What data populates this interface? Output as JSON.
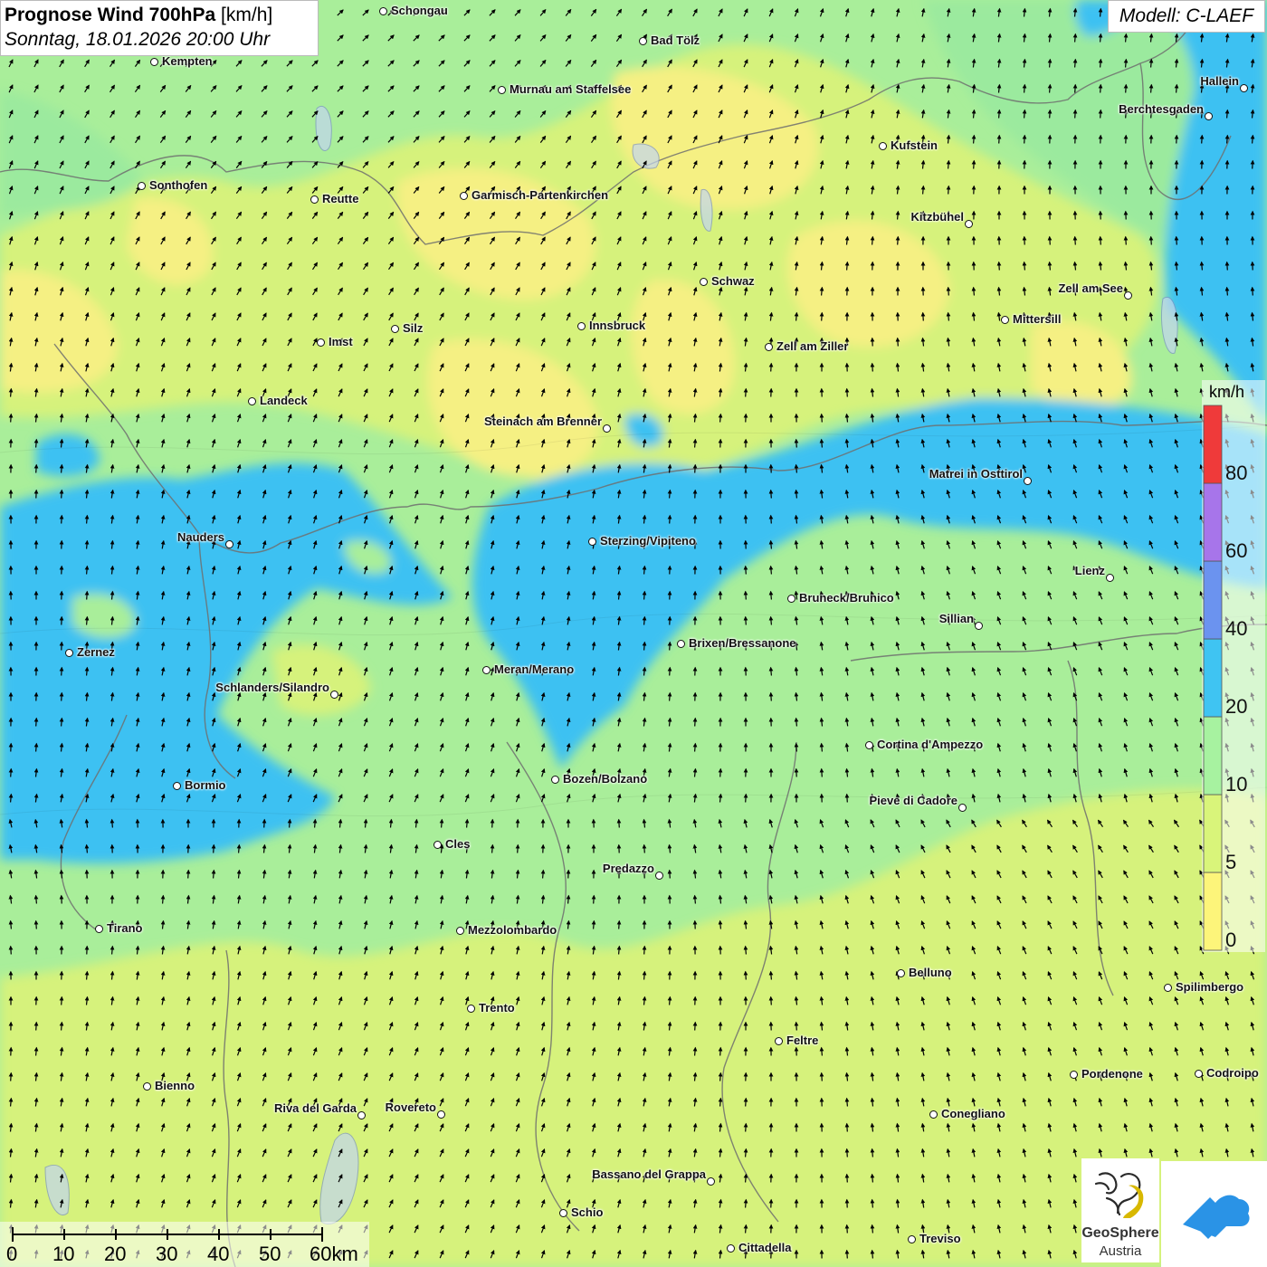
{
  "title": {
    "main_bold": "Prognose Wind 700hPa",
    "unit": "[km/h]",
    "datetime": "Sonntag, 18.01.2026 20:00 Uhr"
  },
  "model": "Modell: C-LAEF",
  "legend": {
    "unit": "km/h",
    "labels": [
      "0",
      "5",
      "10",
      "20",
      "40",
      "60",
      "80"
    ],
    "colors": [
      "#fdf57a",
      "#d9f57a",
      "#a7f2a0",
      "#3fc4f2",
      "#6b93ef",
      "#a775ea",
      "#ef3a3a"
    ]
  },
  "scale": {
    "ticks": [
      "0",
      "10",
      "20",
      "30",
      "40",
      "50",
      "60km"
    ]
  },
  "logos": {
    "geosphere_name": "GeoSphere",
    "geosphere_country": "Austria"
  },
  "places": [
    {
      "name": "Schongau"
    },
    {
      "name": "Kempten"
    },
    {
      "name": "Bad Tölz"
    },
    {
      "name": "Murnau am Staffelsee"
    },
    {
      "name": "Hallein"
    },
    {
      "name": "Berchtesgaden"
    },
    {
      "name": "Kufstein"
    },
    {
      "name": "Sonthofen"
    },
    {
      "name": "Reutte"
    },
    {
      "name": "Garmisch-Partenkirchen"
    },
    {
      "name": "Kitzbühel"
    },
    {
      "name": "Schwaz"
    },
    {
      "name": "Zell am See"
    },
    {
      "name": "Mittersill"
    },
    {
      "name": "Innsbruck"
    },
    {
      "name": "Silz"
    },
    {
      "name": "Imst"
    },
    {
      "name": "Zell am Ziller"
    },
    {
      "name": "Landeck"
    },
    {
      "name": "Steinach am Brenner"
    },
    {
      "name": "Matrei in Osttirol"
    },
    {
      "name": "Nauders"
    },
    {
      "name": "Sterzing/Vipiteno"
    },
    {
      "name": "Lienz"
    },
    {
      "name": "Bruneck/Brunico"
    },
    {
      "name": "Sillian"
    },
    {
      "name": "Zernez"
    },
    {
      "name": "Brixen/Bressanone"
    },
    {
      "name": "Meran/Merano"
    },
    {
      "name": "Schlanders/Silandro"
    },
    {
      "name": "Cortina d'Ampezzo"
    },
    {
      "name": "Bozen/Bolzano"
    },
    {
      "name": "Bormio"
    },
    {
      "name": "Pieve di Cadore"
    },
    {
      "name": "Cles"
    },
    {
      "name": "Predazzo"
    },
    {
      "name": "Tirano"
    },
    {
      "name": "Mezzolombardo"
    },
    {
      "name": "Belluno"
    },
    {
      "name": "Spilimbergo"
    },
    {
      "name": "Trento"
    },
    {
      "name": "Feltre"
    },
    {
      "name": "Pordenone"
    },
    {
      "name": "Codroipo"
    },
    {
      "name": "Bienno"
    },
    {
      "name": "Riva del Garda"
    },
    {
      "name": "Rovereto"
    },
    {
      "name": "Conegliano"
    },
    {
      "name": "Bassano del Grappa"
    },
    {
      "name": "Schio"
    },
    {
      "name": "Treviso"
    },
    {
      "name": "Cittadella"
    }
  ]
}
